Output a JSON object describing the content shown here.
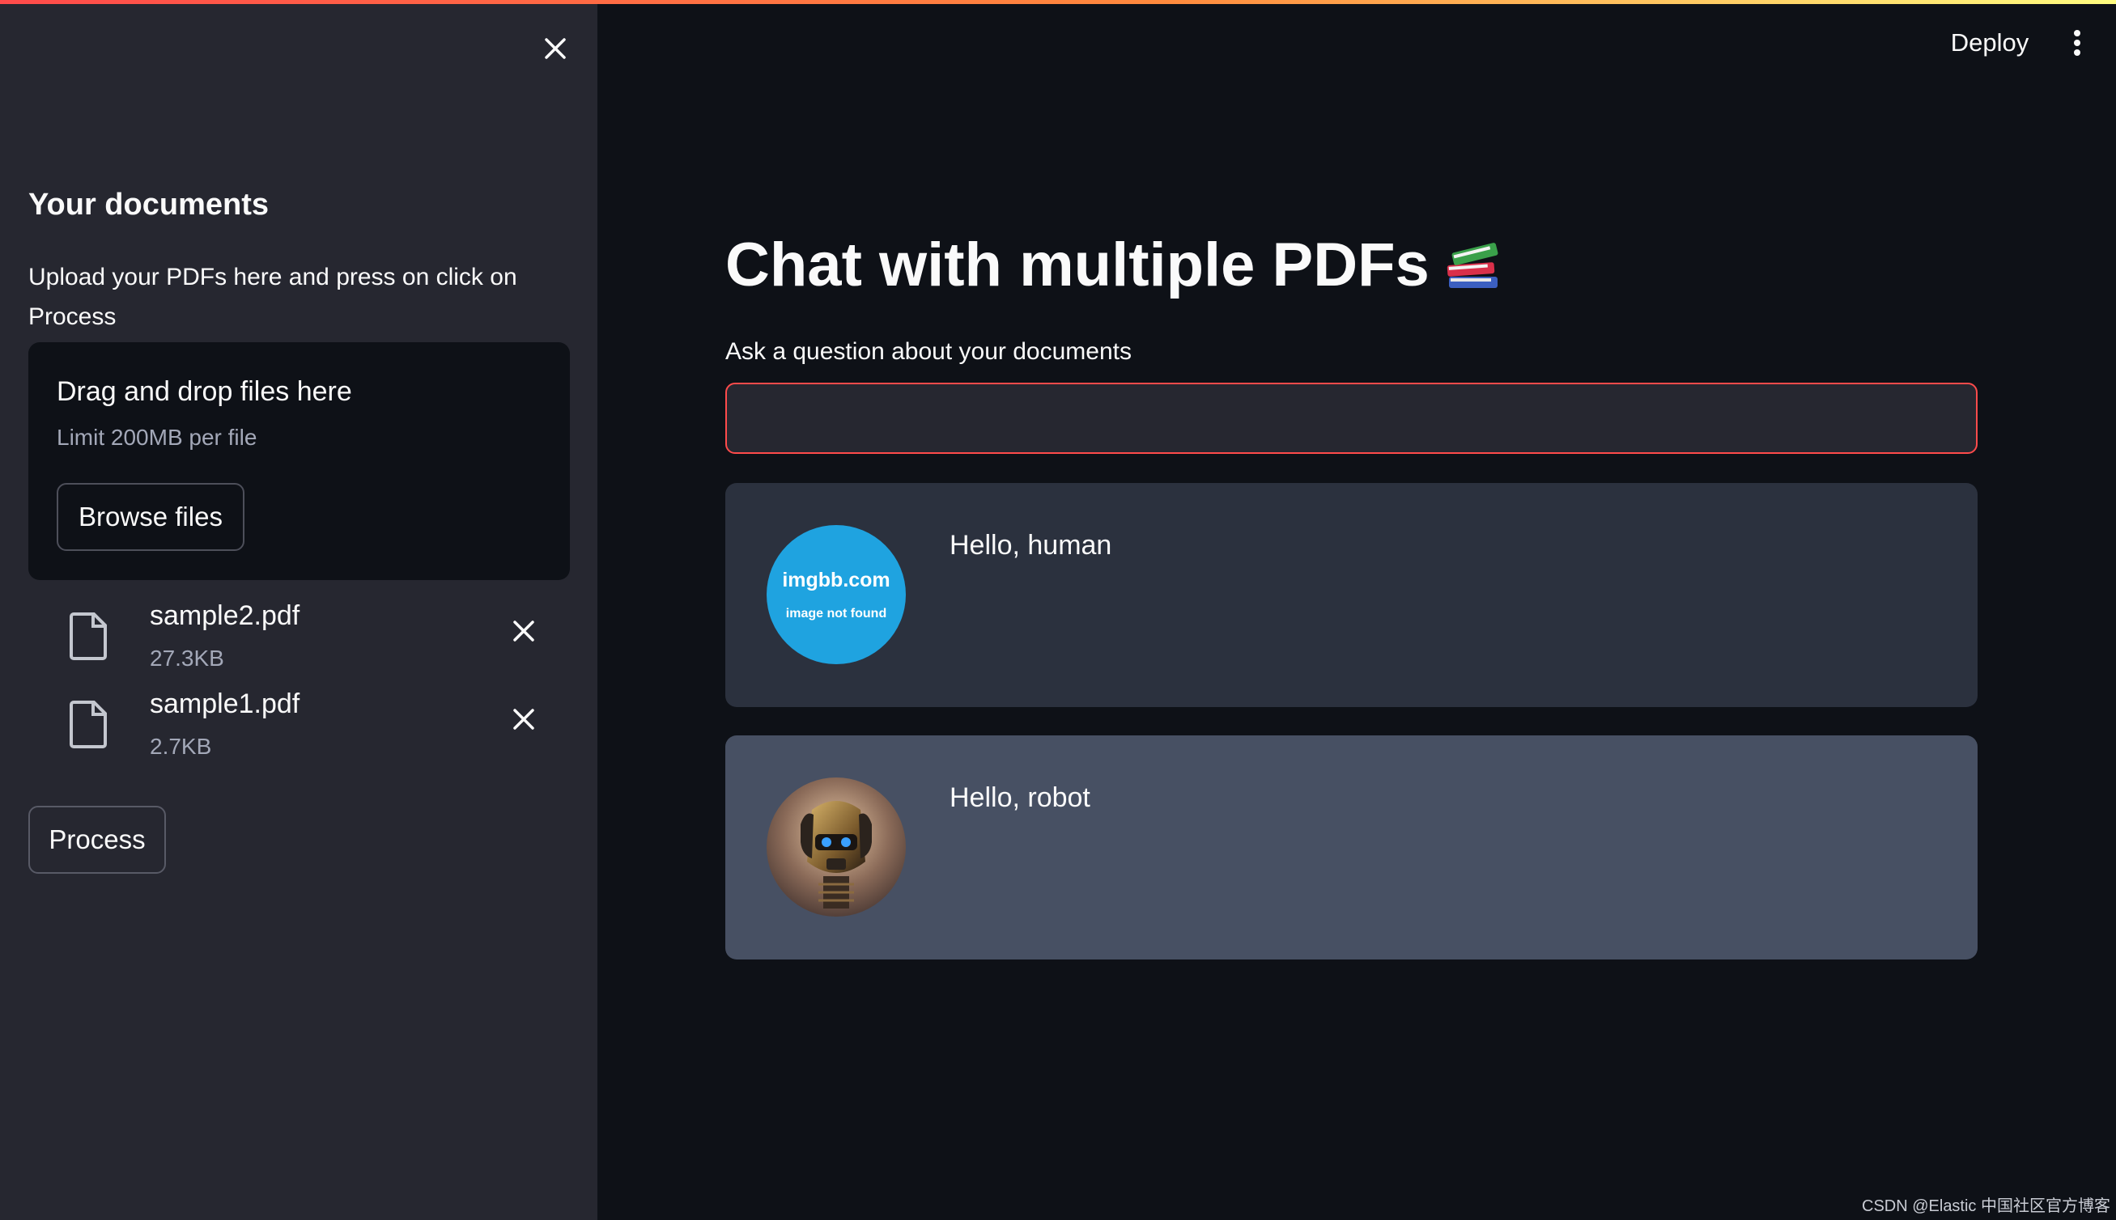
{
  "sidebar": {
    "title": "Your documents",
    "description": "Upload your PDFs here and press on click on Process",
    "dropzone": {
      "title": "Drag and drop files here",
      "limit": "Limit 200MB per file",
      "browse_label": "Browse files"
    },
    "files": [
      {
        "name": "sample2.pdf",
        "size": "27.3KB"
      },
      {
        "name": "sample1.pdf",
        "size": "2.7KB"
      }
    ],
    "process_label": "Process"
  },
  "header": {
    "deploy_label": "Deploy"
  },
  "main": {
    "title": "Chat with multiple PDFs",
    "title_icon": "books-emoji-icon",
    "question_label": "Ask a question about your documents",
    "question_value": "",
    "messages": [
      {
        "role": "human",
        "avatar_title": "imgbb.com",
        "avatar_sub": "image not found",
        "text": "Hello, human"
      },
      {
        "role": "bot",
        "avatar_icon": "robot-avatar",
        "text": "Hello, robot"
      }
    ]
  },
  "watermark": "CSDN @Elastic 中国社区官方博客",
  "colors": {
    "accent": "#ff4b4b",
    "sidebar_bg": "#262730",
    "main_bg": "#0e1117",
    "human_msg_bg": "#2b313e",
    "bot_msg_bg": "#475063",
    "avatar_bg": "#1fa3e0"
  }
}
